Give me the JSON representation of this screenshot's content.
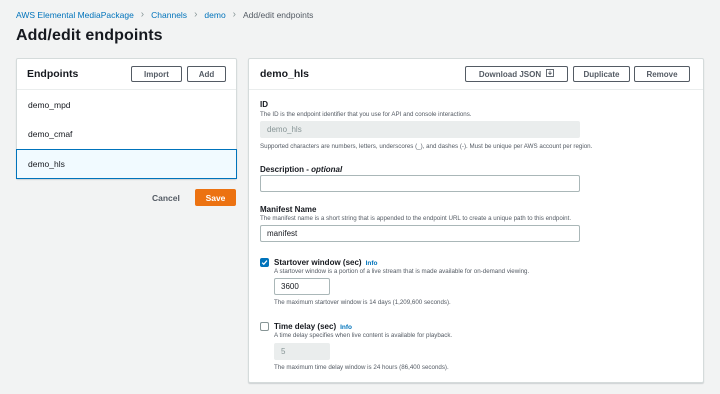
{
  "breadcrumb": {
    "items": [
      "AWS Elemental MediaPackage",
      "Channels",
      "demo"
    ],
    "current": "Add/edit endpoints"
  },
  "page_title": "Add/edit endpoints",
  "left_panel": {
    "title": "Endpoints",
    "import_label": "Import",
    "add_label": "Add",
    "endpoints": [
      "demo_mpd",
      "demo_cmaf",
      "demo_hls"
    ],
    "selected": "demo_hls"
  },
  "actions": {
    "cancel_label": "Cancel",
    "save_label": "Save"
  },
  "right_panel": {
    "title": "demo_hls",
    "download_label": "Download JSON",
    "duplicate_label": "Duplicate",
    "remove_label": "Remove",
    "id": {
      "label": "ID",
      "description": "The ID is the endpoint identifier that you use for API and console interactions.",
      "value": "demo_hls",
      "constraint": "Supported characters are numbers, letters, underscores (_), and dashes (-). Must be unique per AWS account per region."
    },
    "description": {
      "label": "Description",
      "optional": "optional",
      "value": ""
    },
    "manifest": {
      "label": "Manifest Name",
      "description": "The manifest name is a short string that is appended to the endpoint URL to create a unique path to this endpoint.",
      "value": "manifest"
    },
    "startover": {
      "checked": true,
      "label": "Startover window (sec)",
      "info": "Info",
      "description": "A startover window is a portion of a live stream that is made available for on-demand viewing.",
      "value": "3600",
      "hint": "The maximum startover window is 14 days (1,209,600 seconds)."
    },
    "time_delay": {
      "checked": false,
      "label": "Time delay (sec)",
      "info": "Info",
      "description": "A time delay specifies when live content is available for playback.",
      "value": "5",
      "hint": "The maximum time delay window is 24 hours (86,400 seconds)."
    }
  },
  "colors": {
    "link": "#0073bb",
    "primary": "#ec7211",
    "background": "#f2f3f3"
  }
}
